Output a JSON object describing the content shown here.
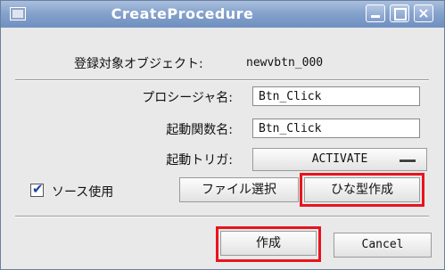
{
  "window": {
    "title": "CreateProcedure",
    "close_glyph": "×"
  },
  "object": {
    "label": "登録対象オブジェクト:",
    "value": "newvbtn_000"
  },
  "form": {
    "procedure_name_label": "プロシージャ名:",
    "procedure_name_value": "Btn_Click",
    "start_function_label": "起動関数名:",
    "start_function_value": "Btn_Click",
    "trigger_label": "起動トリガ:",
    "trigger_value": "ACTIVATE"
  },
  "source": {
    "checkbox_checked": true,
    "checkbox_mark": "✔",
    "checkbox_label": "ソース使用",
    "file_select_label": "ファイル選択",
    "template_create_label": "ひな型作成"
  },
  "actions": {
    "create_label": "作成",
    "cancel_label": "Cancel"
  },
  "colors": {
    "highlight": "#e8141e",
    "titlebar": "#86a3cd"
  }
}
